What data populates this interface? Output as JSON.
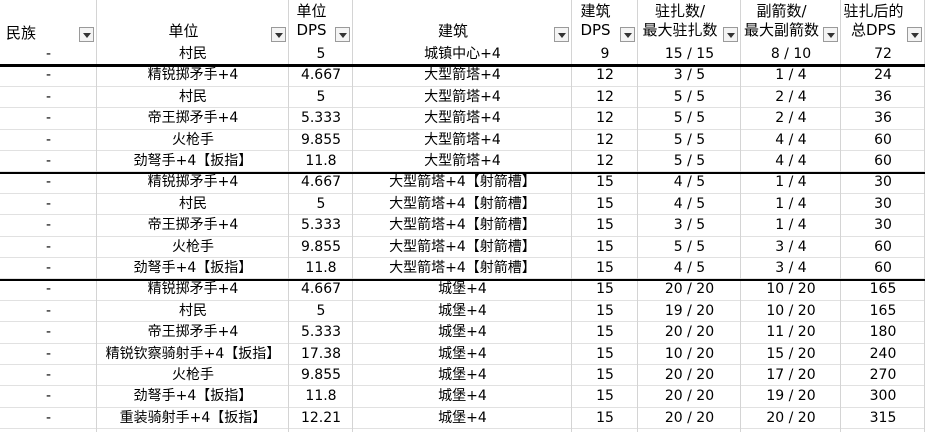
{
  "headers": {
    "race": "民族",
    "unit": "单位",
    "unit_dps": "单位\nDPS",
    "building": "建筑",
    "building_dps": "建筑\nDPS",
    "garrison": "驻扎数/\n最大驻扎数",
    "arrows": "副箭数/\n最大副箭数",
    "total": "驻扎后的\n总DPS"
  },
  "rows": [
    {
      "race": "-",
      "unit": "村民",
      "udps": "5",
      "building": "城镇中心+4",
      "bdps": "9",
      "garrison": "15 / 15",
      "arrows": "8 / 10",
      "total": "72"
    },
    {
      "race": "-",
      "unit": "精锐掷矛手+4",
      "udps": "4.667",
      "building": "大型箭塔+4",
      "bdps": "12",
      "garrison": "3 / 5",
      "arrows": "1 / 4",
      "total": "24"
    },
    {
      "race": "-",
      "unit": "村民",
      "udps": "5",
      "building": "大型箭塔+4",
      "bdps": "12",
      "garrison": "5 / 5",
      "arrows": "2 / 4",
      "total": "36"
    },
    {
      "race": "-",
      "unit": "帝王掷矛手+4",
      "udps": "5.333",
      "building": "大型箭塔+4",
      "bdps": "12",
      "garrison": "5 / 5",
      "arrows": "2 / 4",
      "total": "36"
    },
    {
      "race": "-",
      "unit": "火枪手",
      "udps": "9.855",
      "building": "大型箭塔+4",
      "bdps": "12",
      "garrison": "5 / 5",
      "arrows": "4 / 4",
      "total": "60"
    },
    {
      "race": "-",
      "unit": "劲弩手+4【扳指】",
      "udps": "11.8",
      "building": "大型箭塔+4",
      "bdps": "12",
      "garrison": "5 / 5",
      "arrows": "4 / 4",
      "total": "60"
    },
    {
      "race": "-",
      "unit": "精锐掷矛手+4",
      "udps": "4.667",
      "building": "大型箭塔+4【射箭槽】",
      "bdps": "15",
      "garrison": "4 / 5",
      "arrows": "1 / 4",
      "total": "30"
    },
    {
      "race": "-",
      "unit": "村民",
      "udps": "5",
      "building": "大型箭塔+4【射箭槽】",
      "bdps": "15",
      "garrison": "4 / 5",
      "arrows": "1 / 4",
      "total": "30"
    },
    {
      "race": "-",
      "unit": "帝王掷矛手+4",
      "udps": "5.333",
      "building": "大型箭塔+4【射箭槽】",
      "bdps": "15",
      "garrison": "3 / 5",
      "arrows": "1 / 4",
      "total": "30"
    },
    {
      "race": "-",
      "unit": "火枪手",
      "udps": "9.855",
      "building": "大型箭塔+4【射箭槽】",
      "bdps": "15",
      "garrison": "5 / 5",
      "arrows": "3 / 4",
      "total": "60"
    },
    {
      "race": "-",
      "unit": "劲弩手+4【扳指】",
      "udps": "11.8",
      "building": "大型箭塔+4【射箭槽】",
      "bdps": "15",
      "garrison": "4 / 5",
      "arrows": "3 / 4",
      "total": "60"
    },
    {
      "race": "-",
      "unit": "精锐掷矛手+4",
      "udps": "4.667",
      "building": "城堡+4",
      "bdps": "15",
      "garrison": "20 / 20",
      "arrows": "10 / 20",
      "total": "165"
    },
    {
      "race": "-",
      "unit": "村民",
      "udps": "5",
      "building": "城堡+4",
      "bdps": "15",
      "garrison": "19 / 20",
      "arrows": "10 / 20",
      "total": "165"
    },
    {
      "race": "-",
      "unit": "帝王掷矛手+4",
      "udps": "5.333",
      "building": "城堡+4",
      "bdps": "15",
      "garrison": "20 / 20",
      "arrows": "11 / 20",
      "total": "180"
    },
    {
      "race": "-",
      "unit": "精锐钦察骑射手+4【扳指】",
      "udps": "17.38",
      "building": "城堡+4",
      "bdps": "15",
      "garrison": "10 / 20",
      "arrows": "15 / 20",
      "total": "240"
    },
    {
      "race": "-",
      "unit": "火枪手",
      "udps": "9.855",
      "building": "城堡+4",
      "bdps": "15",
      "garrison": "20 / 20",
      "arrows": "17 / 20",
      "total": "270"
    },
    {
      "race": "-",
      "unit": "劲弩手+4【扳指】",
      "udps": "11.8",
      "building": "城堡+4",
      "bdps": "15",
      "garrison": "20 / 20",
      "arrows": "19 / 20",
      "total": "300"
    },
    {
      "race": "-",
      "unit": "重装骑射手+4【扳指】",
      "udps": "12.21",
      "building": "城堡+4",
      "bdps": "15",
      "garrison": "20 / 20",
      "arrows": "20 / 20",
      "total": "315"
    }
  ]
}
